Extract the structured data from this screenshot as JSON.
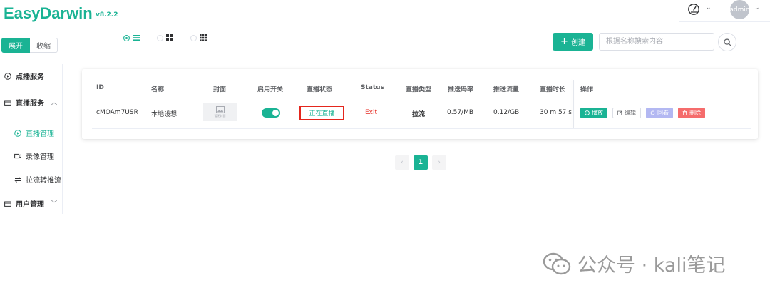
{
  "app": {
    "name": "EasyDarwin",
    "version": "v8.2.2"
  },
  "header": {
    "user": "admin",
    "accent": "#1ab394"
  },
  "sidebar_toggle": {
    "expand_label": "展开",
    "collapse_label": "收缩"
  },
  "sidebar": {
    "items": [
      {
        "label": "点播服务",
        "type": "group",
        "icon": "play-circle-icon"
      },
      {
        "label": "直播服务",
        "type": "group",
        "icon": "monitor-icon",
        "expanded": true
      },
      {
        "label": "直播管理",
        "type": "sub",
        "icon": "play-circle-icon",
        "active": true
      },
      {
        "label": "录像管理",
        "type": "sub",
        "icon": "video-camera-icon"
      },
      {
        "label": "拉流转推流",
        "type": "sub",
        "icon": "swap-icon"
      },
      {
        "label": "用户管理",
        "type": "group",
        "icon": "monitor-icon",
        "expanded": false
      }
    ]
  },
  "toolbar": {
    "create_label": "创建",
    "search_placeholder": "根据名称搜索内容",
    "view_modes": [
      "list-view-icon",
      "grid-4-icon",
      "grid-9-icon"
    ],
    "active_view": 0
  },
  "table": {
    "columns": [
      "ID",
      "名称",
      "封面",
      "启用开关",
      "直播状态",
      "Status",
      "直播类型",
      "推送码率",
      "推送流量",
      "直播时长",
      "操作"
    ],
    "rows": [
      {
        "id": "cMOAm7USR",
        "name": "本地设想",
        "cover_text": "暂无封面",
        "enabled": true,
        "live_status": "正在直播",
        "status": "Exit",
        "type": "拉流",
        "bitrate": "0.57/MB",
        "traffic": "0.12/GB",
        "duration": "30 m 57 s",
        "actions": [
          "播放",
          "编辑",
          "回看",
          "删除"
        ]
      }
    ]
  },
  "pagination": {
    "prev": "‹",
    "current": "1",
    "next": "›"
  },
  "watermark": {
    "text": "公众号 · kali笔记"
  }
}
